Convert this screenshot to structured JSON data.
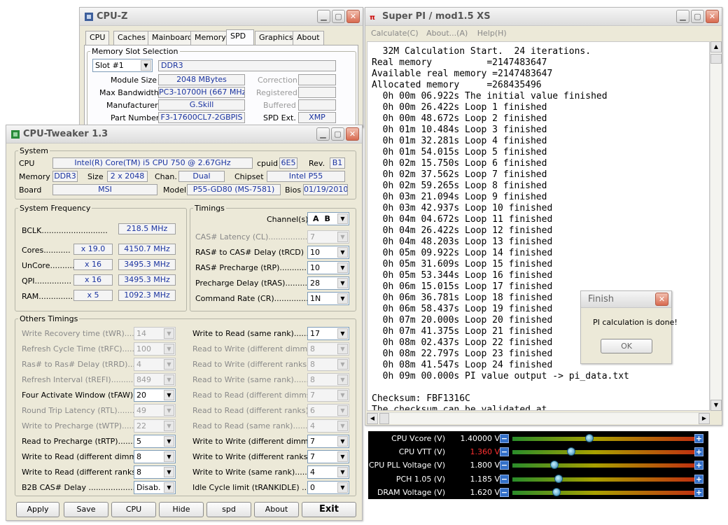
{
  "cpuz": {
    "title": "CPU-Z",
    "tabs": [
      "CPU",
      "Caches",
      "Mainboard",
      "Memory",
      "SPD",
      "Graphics",
      "About"
    ],
    "active_tab": "SPD",
    "slot_group": "Memory Slot Selection",
    "slot": "Slot #1",
    "mem_type": "DDR3",
    "labels": {
      "module_size": "Module Size",
      "max_bandwidth": "Max Bandwidth",
      "manufacturer": "Manufacturer",
      "part_number": "Part Number",
      "correction": "Correction",
      "registered": "Registered",
      "buffered": "Buffered",
      "spd_ext": "SPD Ext."
    },
    "values": {
      "module_size": "2048 MBytes",
      "max_bandwidth": "PC3-10700H (667 MHz)",
      "manufacturer": "G.Skill",
      "part_number": "F3-17600CL7-2GBPIS",
      "spd_ext": "XMP"
    }
  },
  "tweaker": {
    "title": "CPU-Tweaker 1.3",
    "system": {
      "group": "System",
      "cpu_label": "CPU",
      "cpu": "Intel(R) Core(TM) i5 CPU        750  @ 2.67GHz",
      "cpuid_label": "cpuid",
      "cpuid": "6E5",
      "rev_label": "Rev.",
      "rev": "B1",
      "memory_label": "Memory",
      "memory": "DDR3",
      "size_label": "Size",
      "size": "2 x 2048",
      "chan_label": "Chan.",
      "chan": "Dual",
      "chipset_label": "Chipset",
      "chipset": "Intel P55",
      "board_label": "Board",
      "board": "MSI",
      "model_label": "Model",
      "model": "P55-GD80 (MS-7581)",
      "bios_label": "Bios",
      "bios": "01/19/2010"
    },
    "freq": {
      "group": "System Frequency",
      "bclk_label": "BCLK...........................",
      "bclk": "218.5 MHz",
      "cores_label": "Cores...........",
      "cores_mult": "x 19.0",
      "cores": "4150.7 MHz",
      "uncore_label": "UnCore..........",
      "uncore_mult": "x 16",
      "uncore": "3495.3 MHz",
      "qpi_label": "QPI...............",
      "qpi_mult": "x 16",
      "qpi": "3495.3 MHz",
      "ram_label": "RAM..............",
      "ram_mult": "x 5",
      "ram": "1092.3 MHz"
    },
    "timings": {
      "group": "Timings",
      "channel_label": "Channel(s)",
      "channel_a": "A",
      "channel_b": "B",
      "cl_label": "CAS# Latency (CL).................",
      "cl": "7",
      "trcd_label": "RAS# to CAS# Delay (tRCD)",
      "trcd": "10",
      "trp_label": "RAS# Precharge (tRP)............",
      "trp": "10",
      "tras_label": "Precharge Delay (tRAS)..........",
      "tras": "28",
      "cr_label": "Command Rate (CR)...............",
      "cr": "1N"
    },
    "others": {
      "group": "Others Timings",
      "left": [
        {
          "label": "Write Recovery time (tWR)...........",
          "value": "14",
          "disabled": true
        },
        {
          "label": "Refresh Cycle Time (tRFC)..........",
          "value": "100",
          "disabled": true
        },
        {
          "label": "Ras# to Ras# Delay (tRRD)..........",
          "value": "4",
          "disabled": true
        },
        {
          "label": "Refresh Interval (tREFI)............",
          "value": "849",
          "disabled": true
        },
        {
          "label": "Four Activate Window (tFAW)......",
          "value": "20",
          "disabled": false
        },
        {
          "label": "Round Trip Latency (RTL)..........",
          "value": "49",
          "disabled": true
        },
        {
          "label": "Write to Precharge (tWTP)..........",
          "value": "22",
          "disabled": true
        },
        {
          "label": "Read to Precharge (tRTP)...........",
          "value": "5",
          "disabled": false
        },
        {
          "label": "Write to Read (different dimms)...",
          "value": "8",
          "disabled": false
        },
        {
          "label": "Write to Read (different ranks)...",
          "value": "8",
          "disabled": false
        },
        {
          "label": "B2B CAS# Delay ........................",
          "value": "Disab.",
          "disabled": false
        }
      ],
      "right": [
        {
          "label": "Write to Read (same rank)............",
          "value": "17",
          "disabled": false
        },
        {
          "label": "Read to Write (different dimms).....",
          "value": "8",
          "disabled": true
        },
        {
          "label": "Read to Write (different ranks).....",
          "value": "8",
          "disabled": true
        },
        {
          "label": "Read to Write (same rank)...........",
          "value": "8",
          "disabled": true
        },
        {
          "label": "Read to Read (different dimms).....",
          "value": "7",
          "disabled": true
        },
        {
          "label": "Read to Read (different ranks).....",
          "value": "6",
          "disabled": true
        },
        {
          "label": "Read to Read (same rank)...........",
          "value": "4",
          "disabled": true
        },
        {
          "label": "Write to Write (different dimms)....",
          "value": "7",
          "disabled": false
        },
        {
          "label": "Write to Write (different ranks)....",
          "value": "7",
          "disabled": false
        },
        {
          "label": "Write to Write (same rank)...........",
          "value": "4",
          "disabled": false
        },
        {
          "label": "Idle Cycle limit (tRANKIDLE) .........",
          "value": "0",
          "disabled": false
        }
      ]
    },
    "buttons": [
      "Apply",
      "Save",
      "CPU",
      "Hide",
      "spd",
      "About",
      "Exit"
    ]
  },
  "superpi": {
    "title": "Super PI / mod1.5 XS",
    "menu": [
      "Calculate(C)",
      "About...(A)",
      "Help(H)"
    ],
    "lines": [
      "  32M Calculation Start.  24 iterations.",
      "Real memory          =2147483647",
      "Available real memory =2147483647",
      "Allocated memory     =268435496",
      "  0h 00m 06.922s The initial value finished",
      "  0h 00m 26.422s Loop 1 finished",
      "  0h 00m 48.672s Loop 2 finished",
      "  0h 01m 10.484s Loop 3 finished",
      "  0h 01m 32.281s Loop 4 finished",
      "  0h 01m 54.015s Loop 5 finished",
      "  0h 02m 15.750s Loop 6 finished",
      "  0h 02m 37.562s Loop 7 finished",
      "  0h 02m 59.265s Loop 8 finished",
      "  0h 03m 21.094s Loop 9 finished",
      "  0h 03m 42.937s Loop 10 finished",
      "  0h 04m 04.672s Loop 11 finished",
      "  0h 04m 26.422s Loop 12 finished",
      "  0h 04m 48.203s Loop 13 finished",
      "  0h 05m 09.922s Loop 14 finished",
      "  0h 05m 31.609s Loop 15 finished",
      "  0h 05m 53.344s Loop 16 finished",
      "  0h 06m 15.015s Loop 17 finished",
      "  0h 06m 36.781s Loop 18 finished",
      "  0h 06m 58.437s Loop 19 finished",
      "  0h 07m 20.000s Loop 20 finished",
      "  0h 07m 41.375s Loop 21 finished",
      "  0h 08m 02.437s Loop 22 finished",
      "  0h 08m 22.797s Loop 23 finished",
      "  0h 08m 41.547s Loop 24 finished",
      "  0h 09m 00.000s PI value output -> pi_data.txt",
      "",
      "Checksum: FBF1316C",
      "The checksum can be validated at"
    ]
  },
  "finish": {
    "title": "Finish",
    "message": "PI calculation is done!",
    "ok": "OK"
  },
  "voltages": [
    {
      "name": "CPU Vcore (V)",
      "value": "1.40000 V",
      "level": 0.42,
      "color": "#ffffff"
    },
    {
      "name": "CPU VTT (V)",
      "value": "1.360 V",
      "level": 0.32,
      "color": "#ff3030"
    },
    {
      "name": "CPU PLL Voltage (V)",
      "value": "1.800 V",
      "level": 0.23,
      "color": "#ffffff"
    },
    {
      "name": "PCH 1.05 (V)",
      "value": "1.185 V",
      "level": 0.25,
      "color": "#ffffff"
    },
    {
      "name": "DRAM Voltage (V)",
      "value": "1.620 V",
      "level": 0.24,
      "color": "#ffffff"
    }
  ]
}
